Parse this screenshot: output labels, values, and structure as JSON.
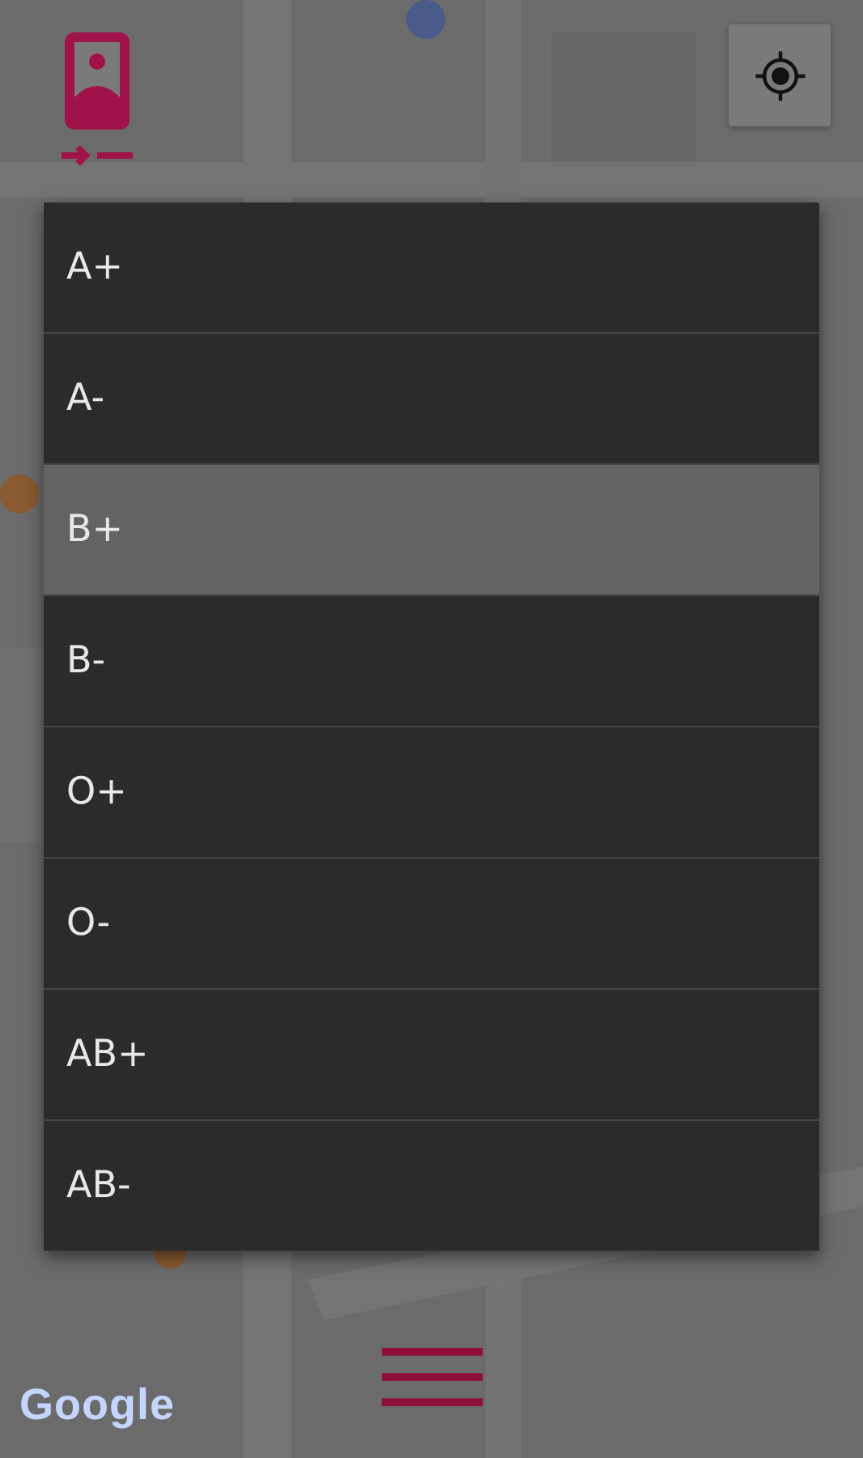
{
  "blood_type_menu": {
    "options": [
      {
        "label": "A+",
        "selected": false
      },
      {
        "label": "A-",
        "selected": false
      },
      {
        "label": "B+",
        "selected": true
      },
      {
        "label": "B-",
        "selected": false
      },
      {
        "label": "O+",
        "selected": false
      },
      {
        "label": "O-",
        "selected": false
      },
      {
        "label": "AB+",
        "selected": false
      },
      {
        "label": "AB-",
        "selected": false
      }
    ]
  },
  "map": {
    "kind": "picture",
    "attribution": "Google"
  }
}
